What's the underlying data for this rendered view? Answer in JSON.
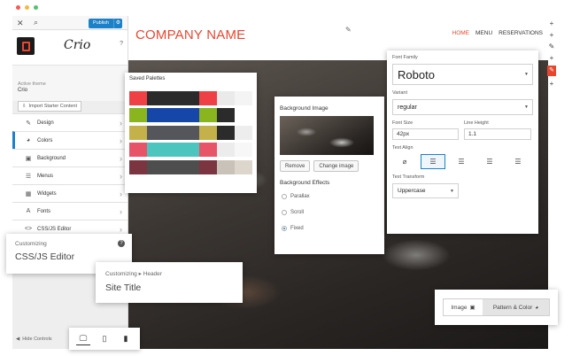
{
  "window": {
    "dot_colors": [
      "#f25c54",
      "#f5b83c",
      "#52c46a"
    ]
  },
  "customizer": {
    "close_glyph": "✕",
    "search_glyph": "🔍",
    "publish_label": "Publish",
    "brand_logo_text": "Crio",
    "help_glyph": "?",
    "active_theme_label": "Active theme",
    "active_theme_value": "Crio",
    "import_label": "Import Starter Content",
    "menu": [
      {
        "label": "Design",
        "icon": "design-icon"
      },
      {
        "label": "Colors",
        "icon": "palette-icon"
      },
      {
        "label": "Background",
        "icon": "image-icon"
      },
      {
        "label": "Menus",
        "icon": "menu-icon"
      },
      {
        "label": "Widgets",
        "icon": "widgets-icon"
      },
      {
        "label": "Fonts",
        "icon": "fonts-icon"
      },
      {
        "label": "CSS/JS Editor",
        "icon": "code-icon"
      }
    ],
    "hide_controls_label": "Hide Controls"
  },
  "site": {
    "company_name": "COMPANY NAME",
    "nav": [
      "HOME",
      "MENU",
      "RESERVATIONS"
    ]
  },
  "saved_palettes": {
    "title": "Saved Palettes",
    "rows": [
      [
        "#ee4045",
        "#2b2b2b",
        "#2b2b2b",
        "#ee4045",
        "#eaeaea",
        "#f4f4f4"
      ],
      [
        "#8ab51f",
        "#1546a8",
        "#1546a8",
        "#8ab51f",
        "#2b2b2b",
        "#ffffff"
      ],
      [
        "#c4b14a",
        "#55565c",
        "#55565c",
        "#c4b14a",
        "#2b2b2b",
        "#ededed"
      ],
      [
        "#e75468",
        "#4dc5bf",
        "#4dc5bf",
        "#e75468",
        "#ececec",
        "#f7f7f7"
      ],
      [
        "#7a3540",
        "#4e4e4e",
        "#4e4e4e",
        "#7a3540",
        "#c9c2b8",
        "#ddd6cc"
      ]
    ]
  },
  "background_panel": {
    "title": "Background Image",
    "remove_label": "Remove",
    "change_label": "Change image",
    "effects_title": "Background Effects",
    "effects": [
      "Parallax",
      "Scroll",
      "Fixed"
    ],
    "selected_effect": "Fixed"
  },
  "typography": {
    "font_family_label": "Font Family",
    "font_family_value": "Roboto",
    "variant_label": "Variant",
    "variant_value": "regular",
    "font_size_label": "Font Size",
    "font_size_value": "42px",
    "line_height_label": "Line Height",
    "line_height_value": "1.1",
    "text_align_label": "Text Align",
    "align_options": [
      "clear",
      "left",
      "center",
      "right",
      "justify"
    ],
    "selected_align": "left",
    "text_transform_label": "Text Transform",
    "text_transform_value": "Uppercase"
  },
  "card_css": {
    "label": "Customizing",
    "value": "CSS/JS Editor"
  },
  "card_header": {
    "label": "Customizing ▸ Header",
    "value": "Site Title"
  },
  "bg_toggle": {
    "image_label": "Image",
    "pattern_label": "Pattern & Color"
  },
  "device_bar": {
    "devices": [
      "desktop",
      "tablet",
      "mobile"
    ],
    "selected": "desktop"
  },
  "accent_colors": {
    "primary": "#1c81c8",
    "brand": "#e8472f"
  }
}
